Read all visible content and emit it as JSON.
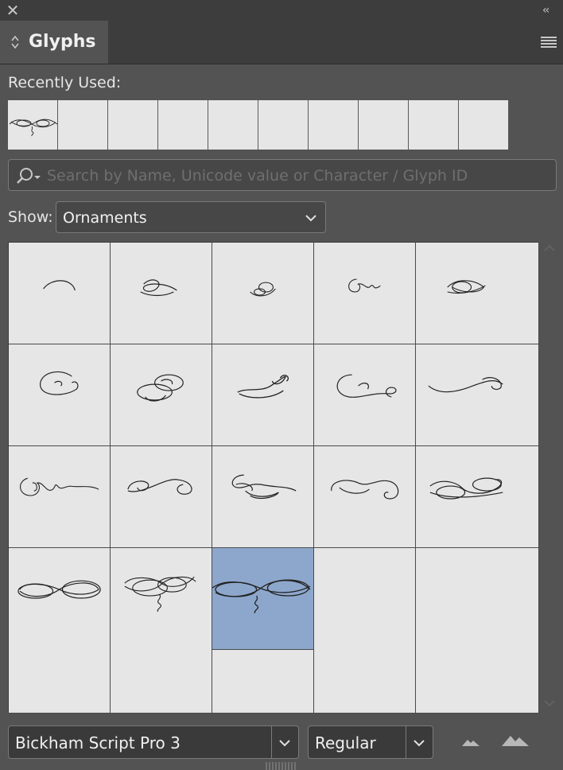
{
  "window": {
    "close_glyph": "✕",
    "collapse_glyph": "‹‹"
  },
  "panel": {
    "title": "Glyphs",
    "menu_icon": "hamburger-menu-icon"
  },
  "recently_used": {
    "label": "Recently Used:",
    "slots": 10,
    "filled": [
      "ornament-flourish"
    ]
  },
  "search": {
    "placeholder": "Search by Name, Unicode value or Character / Glyph ID",
    "value": ""
  },
  "show": {
    "label": "Show:",
    "selected": "Ornaments"
  },
  "glyph_grid": {
    "columns": 5,
    "rows_visible": 4,
    "glyphs": [
      "ornament-1",
      "ornament-2",
      "ornament-3",
      "ornament-4",
      "ornament-5",
      "ornament-6",
      "ornament-7",
      "ornament-8",
      "ornament-9",
      "ornament-10",
      "ornament-11",
      "ornament-12",
      "ornament-13",
      "ornament-14",
      "ornament-15",
      "ornament-16",
      "ornament-17",
      "ornament-18"
    ],
    "selected_index": 17,
    "selected_color": "#8da7cc"
  },
  "footer": {
    "font_family": "Bickham Script Pro 3",
    "font_style": "Regular"
  }
}
